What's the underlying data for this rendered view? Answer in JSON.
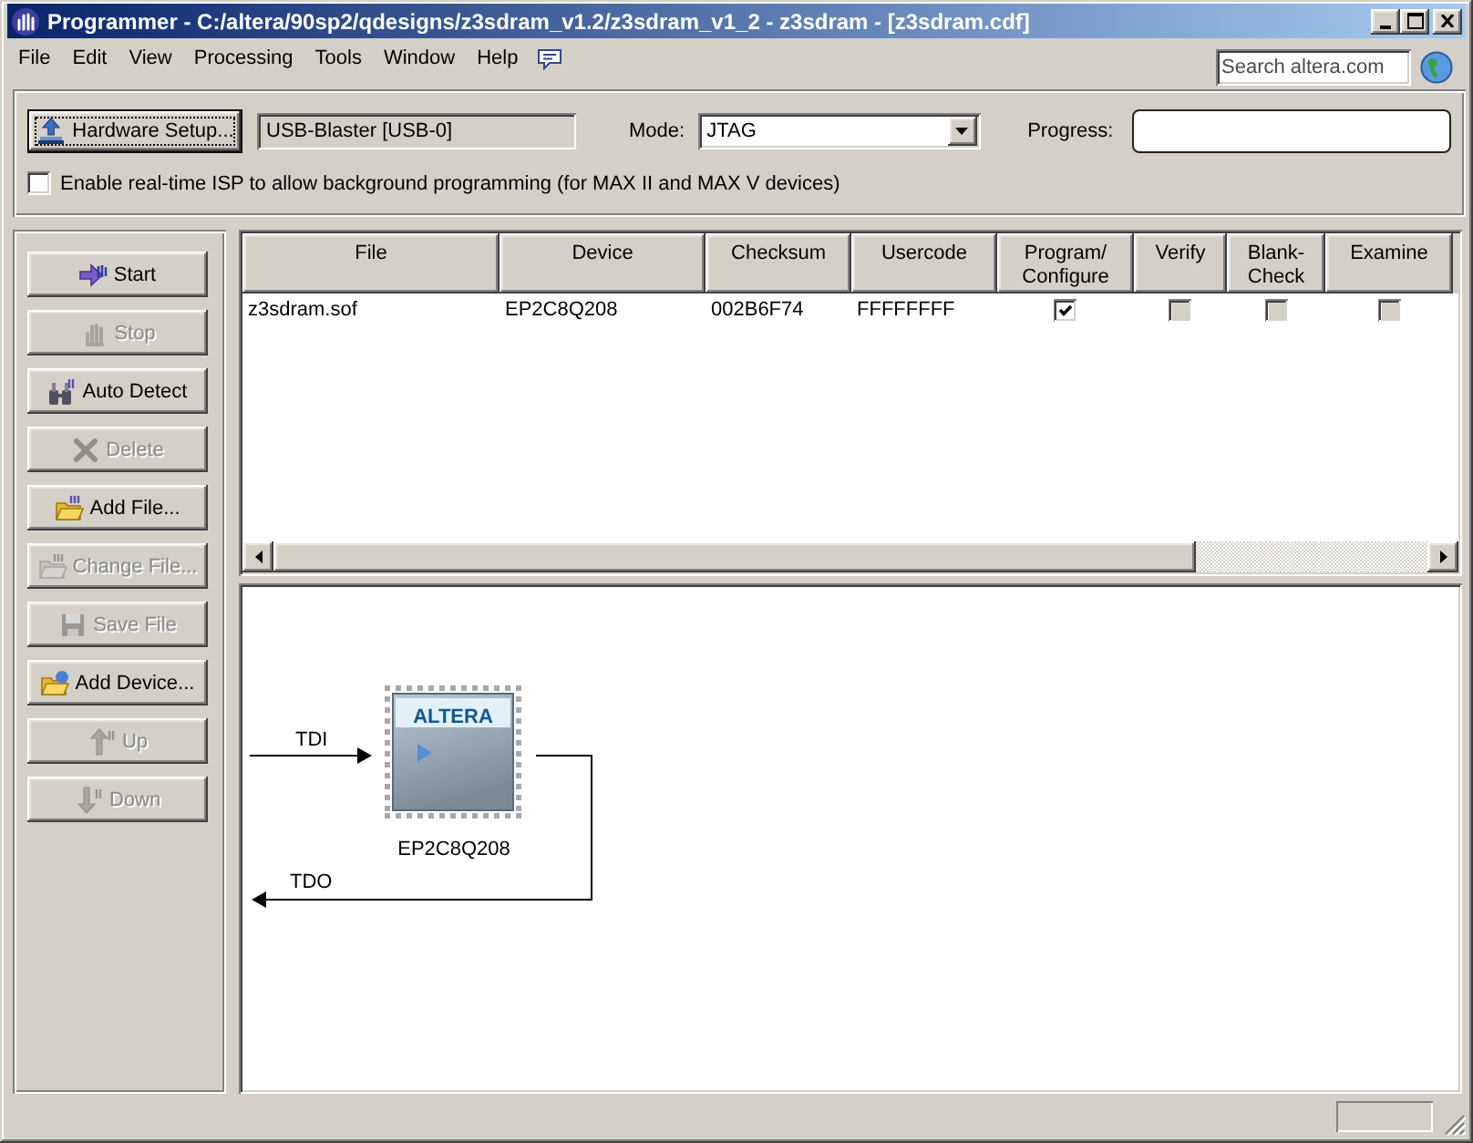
{
  "window": {
    "title": "Programmer - C:/altera/90sp2/qdesigns/z3sdram_v1.2/z3sdram_v1_2 - z3sdram - [z3sdram.cdf]"
  },
  "menu": [
    "File",
    "Edit",
    "View",
    "Processing",
    "Tools",
    "Window",
    "Help"
  ],
  "search": {
    "placeholder": "Search altera.com"
  },
  "toolbar": {
    "hardware_button": {
      "label": "Hardware Setup...",
      "focused": true
    },
    "hardware": "USB-Blaster [USB-0]",
    "mode": {
      "label": "Mode:",
      "value": "JTAG"
    },
    "progress": {
      "label": "Progress:",
      "level": 0
    }
  },
  "isp_option": {
    "label": "Enable real-time ISP to allow background programming (for MAX II and MAX V devices)",
    "checked": false
  },
  "actions": [
    {
      "label": "Start",
      "disabled": false
    },
    {
      "label": "Stop",
      "disabled": true
    },
    {
      "label": "Auto Detect",
      "disabled": false
    },
    {
      "label": "Delete",
      "disabled": true
    },
    {
      "label": "Add File...",
      "disabled": false
    },
    {
      "label": "Change File...",
      "disabled": true
    },
    {
      "label": "Save File",
      "disabled": true
    },
    {
      "label": "Add Device...",
      "disabled": false
    },
    {
      "label": "Up",
      "disabled": true
    },
    {
      "label": "Down",
      "disabled": true
    }
  ],
  "table": {
    "columns": [
      "File",
      "Device",
      "Checksum",
      "Usercode",
      "Program/Configure",
      "Verify",
      "Blank-Check",
      "Examine"
    ],
    "rows": [
      {
        "cells": [
          {
            "kind": "text",
            "text": "z3sdram.sof"
          },
          {
            "kind": "text",
            "text": "EP2C8Q208"
          },
          {
            "kind": "text",
            "text": "002B6F74"
          },
          {
            "kind": "text",
            "text": "FFFFFFFF"
          },
          {
            "kind": "checkbox",
            "checked": true,
            "disabled": false
          },
          {
            "kind": "checkbox",
            "checked": false,
            "disabled": true
          },
          {
            "kind": "checkbox",
            "checked": false,
            "disabled": true
          },
          {
            "kind": "checkbox",
            "checked": false,
            "disabled": true
          }
        ]
      }
    ]
  },
  "chain": {
    "input_label": "TDI",
    "output_label": "TDO",
    "devices": [
      {
        "logo": "ALTERA",
        "label": "EP2C8Q208"
      }
    ]
  }
}
